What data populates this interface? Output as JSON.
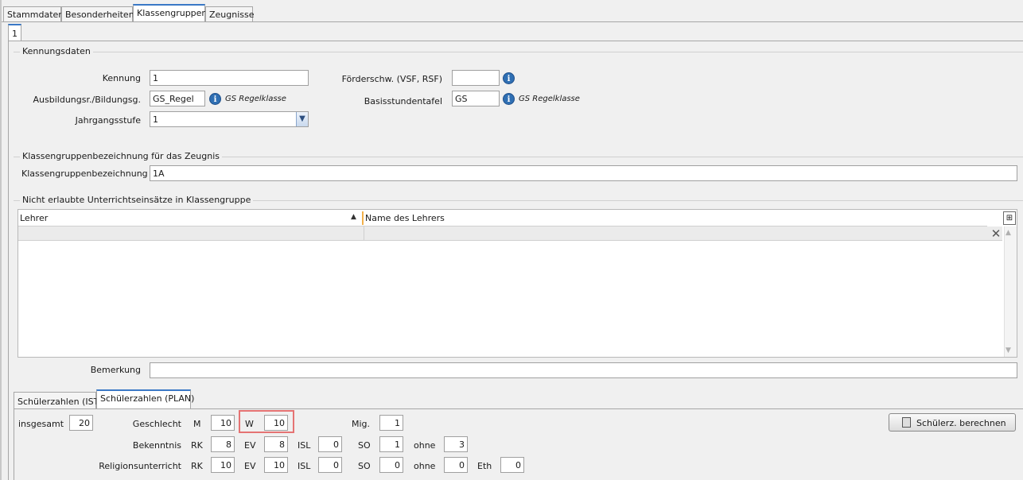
{
  "tabs": [
    "Stammdaten",
    "Besonderheiten",
    "Klassengruppen",
    "Zeugnisse"
  ],
  "subtab": "1",
  "kennungsdaten": {
    "title": "Kennungsdaten",
    "kennung_label": "Kennung",
    "kennung_value": "1",
    "ausbildung_label": "Ausbildungsr./Bildungsg.",
    "ausbildung_value": "GS_Regel",
    "ausbildung_desc": "GS Regelklasse",
    "jahrgang_label": "Jahrgangsstufe",
    "jahrgang_value": "1",
    "foerder_label": "Förderschw. (VSF, RSF)",
    "foerder_value": "",
    "basis_label": "Basisstundentafel",
    "basis_value": "GS",
    "basis_desc": "GS Regelklasse"
  },
  "bezeichnung": {
    "title": "Klassengruppenbezeichnung für das Zeugnis",
    "label": "Klassengruppenbezeichnung",
    "value": "1A"
  },
  "nicht_erlaubt": {
    "title": "Nicht erlaubte Unterrichtseinsätze in Klassengruppe",
    "col1": "Lehrer",
    "col2": "Name des Lehrers"
  },
  "bemerkung": {
    "label": "Bemerkung",
    "value": ""
  },
  "schuelerzahlen": {
    "tabs": [
      "Schülerzahlen (IST)",
      "Schülerzahlen (PLAN)"
    ],
    "insgesamt_label": "insgesamt",
    "insgesamt": "20",
    "geschlecht_label": "Geschlecht",
    "m_label": "M",
    "m": "10",
    "w_label": "W",
    "w": "10",
    "mig_label": "Mig.",
    "mig": "1",
    "bekenntnis_label": "Bekenntnis",
    "bek": {
      "rk_label": "RK",
      "rk": "8",
      "ev_label": "EV",
      "ev": "8",
      "isl_label": "ISL",
      "isl": "0",
      "so_label": "SO",
      "so": "1",
      "ohne_label": "ohne",
      "ohne": "3"
    },
    "religion_label": "Religionsunterricht",
    "rel": {
      "rk_label": "RK",
      "rk": "10",
      "ev_label": "EV",
      "ev": "10",
      "isl_label": "ISL",
      "isl": "0",
      "so_label": "SO",
      "so": "0",
      "ohne_label": "ohne",
      "ohne": "0",
      "eth_label": "Eth",
      "eth": "0"
    },
    "calc_button": "Schülerz. berechnen"
  },
  "colors": {
    "accent": "#3a78c6",
    "highlight": "#e57373"
  }
}
